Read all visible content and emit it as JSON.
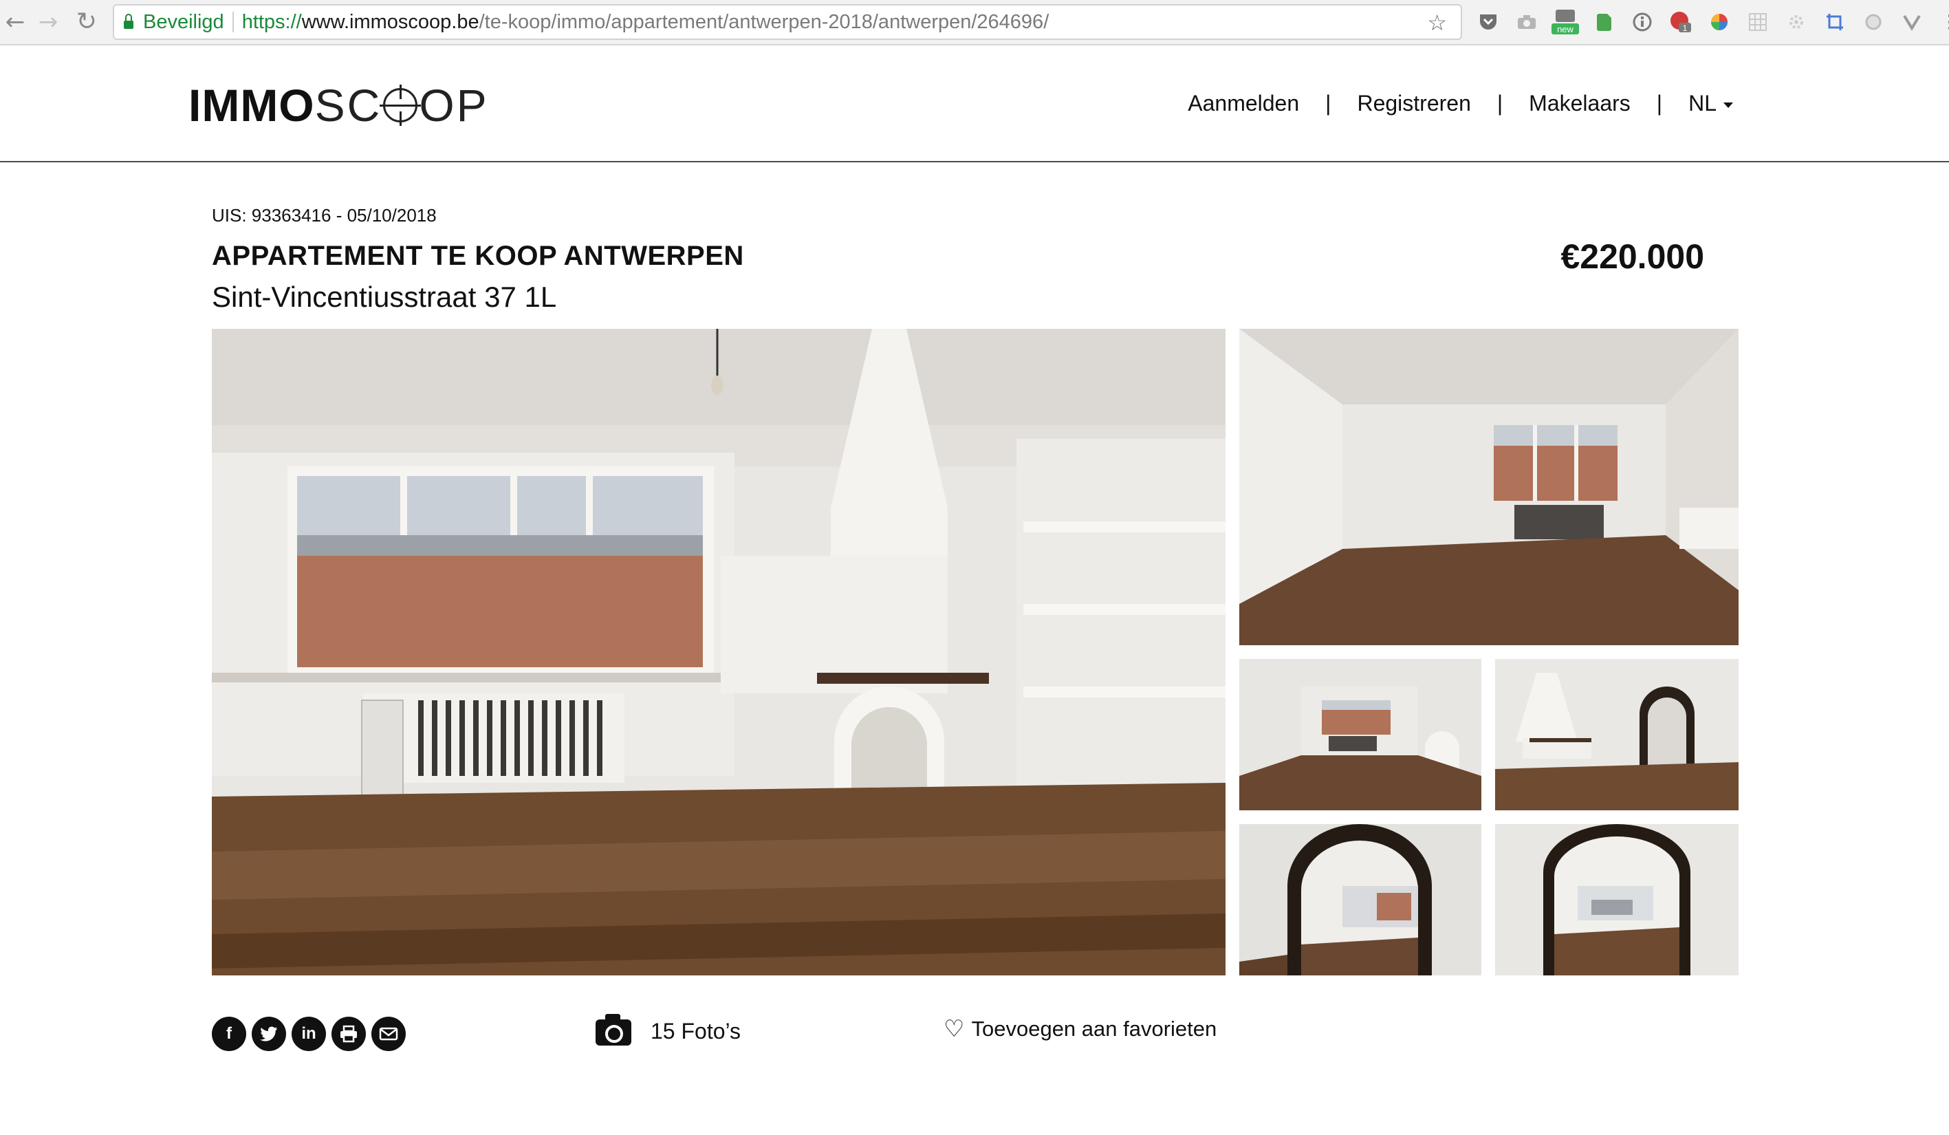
{
  "browser": {
    "secure_label": "Beveiligd",
    "url_proto": "https://",
    "url_host": "www.immoscoop.be",
    "url_path": "/te-koop/immo/appartement/antwerpen-2018/antwerpen/264696/",
    "extensions": [
      "pocket-icon",
      "camera-icon",
      "new-badge-icon",
      "evernote-icon",
      "info-icon",
      "notification-icon",
      "color-wheel-icon",
      "grid-icon",
      "gear-icon",
      "crop-icon",
      "circle-icon",
      "vimeo-icon",
      "menu-icon"
    ]
  },
  "header": {
    "logo_bold": "IMMO",
    "logo_light_1": "SC",
    "logo_light_2": "OP",
    "nav": {
      "login": "Aanmelden",
      "register": "Registreren",
      "brokers": "Makelaars",
      "language": "NL",
      "divider": "|"
    }
  },
  "listing": {
    "uis": "UIS: 93363416 - 05/10/2018",
    "title": "APPARTEMENT TE KOOP ANTWERPEN",
    "address": "Sint-Vincentiusstraat 37 1L",
    "price": "€220.000"
  },
  "actions": {
    "share": {
      "facebook": "f",
      "twitter": "t",
      "linkedin": "in",
      "print": "⎙",
      "email": "✉"
    },
    "photo_count": "15 Foto’s",
    "favorite": "Toevoegen aan favorieten"
  },
  "colors": {
    "secure_green": "#1a8a3a",
    "text": "#111111",
    "wall": "#eceae6",
    "floor": "#6b4a30"
  }
}
